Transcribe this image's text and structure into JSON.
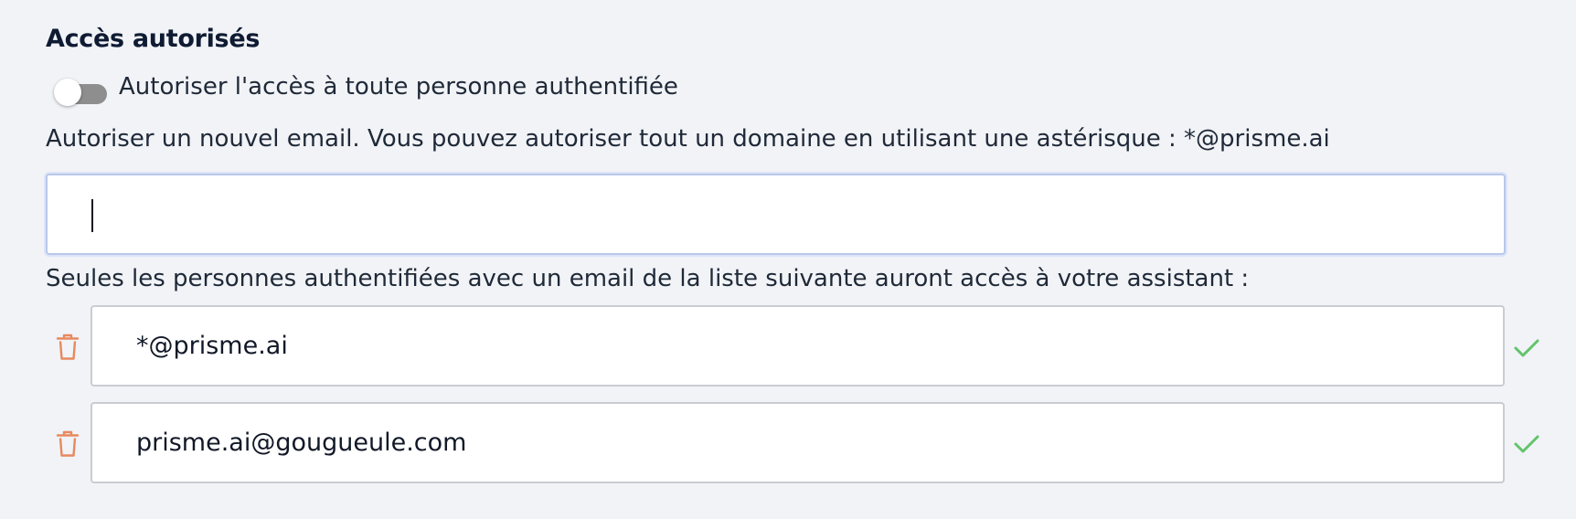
{
  "section": {
    "title": "Accès autorisés"
  },
  "toggle": {
    "label": "Autoriser l'accès à toute personne authentifiée",
    "checked": false
  },
  "new_email": {
    "help": "Autoriser un nouvel email. Vous pouvez autoriser tout un domaine en utilisant une astérisque : *@prisme.ai",
    "value": "",
    "placeholder": ""
  },
  "allowed_list": {
    "caption": "Seules les personnes authentifiées avec un email de la liste suivante auront accès à votre assistant :",
    "items": [
      {
        "email": "*@prisme.ai",
        "delete_icon": "trash-icon",
        "status_icon": "check-icon"
      },
      {
        "email": "prisme.ai@gougueule.com",
        "delete_icon": "trash-icon",
        "status_icon": "check-icon"
      }
    ]
  },
  "colors": {
    "background": "#f1f3f7",
    "title": "#0f1b33",
    "trash": "#e8895e",
    "check": "#63c46b",
    "toggle_off": "#8e8e8e",
    "focus_border": "#b9c7ea"
  }
}
